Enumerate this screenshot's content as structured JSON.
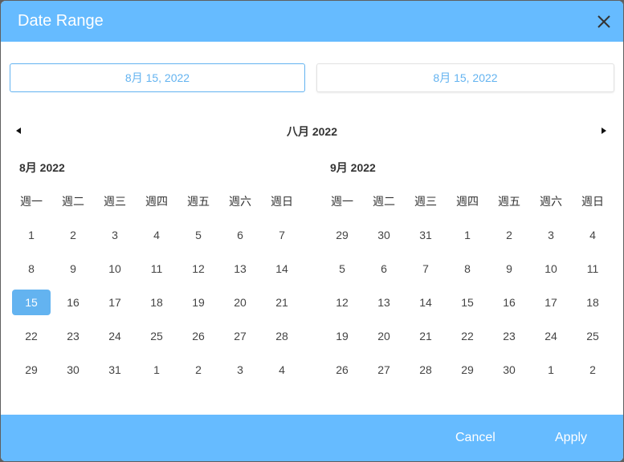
{
  "dialog": {
    "title": "Date Range",
    "close_icon": "close-icon"
  },
  "inputs": {
    "start": "8月 15, 2022",
    "end": "8月 15, 2022"
  },
  "nav": {
    "range_title": "八月 2022",
    "prev_icon": "triangle-left-icon",
    "next_icon": "triangle-right-icon"
  },
  "weekdays": [
    "週一",
    "週二",
    "週三",
    "週四",
    "週五",
    "週六",
    "週日"
  ],
  "months": [
    {
      "title": "8月 2022",
      "weeks": [
        [
          "1",
          "2",
          "3",
          "4",
          "5",
          "6",
          "7"
        ],
        [
          "8",
          "9",
          "10",
          "11",
          "12",
          "13",
          "14"
        ],
        [
          "15",
          "16",
          "17",
          "18",
          "19",
          "20",
          "21"
        ],
        [
          "22",
          "23",
          "24",
          "25",
          "26",
          "27",
          "28"
        ],
        [
          "29",
          "30",
          "31",
          "1",
          "2",
          "3",
          "4"
        ]
      ],
      "selected_day": "15"
    },
    {
      "title": "9月 2022",
      "weeks": [
        [
          "29",
          "30",
          "31",
          "1",
          "2",
          "3",
          "4"
        ],
        [
          "5",
          "6",
          "7",
          "8",
          "9",
          "10",
          "11"
        ],
        [
          "12",
          "13",
          "14",
          "15",
          "16",
          "17",
          "18"
        ],
        [
          "19",
          "20",
          "21",
          "22",
          "23",
          "24",
          "25"
        ],
        [
          "26",
          "27",
          "28",
          "29",
          "30",
          "1",
          "2"
        ]
      ],
      "selected_day": null
    }
  ],
  "footer": {
    "cancel_label": "Cancel",
    "apply_label": "Apply"
  },
  "colors": {
    "accent": "#66bbff",
    "selected": "#63b3f0"
  }
}
